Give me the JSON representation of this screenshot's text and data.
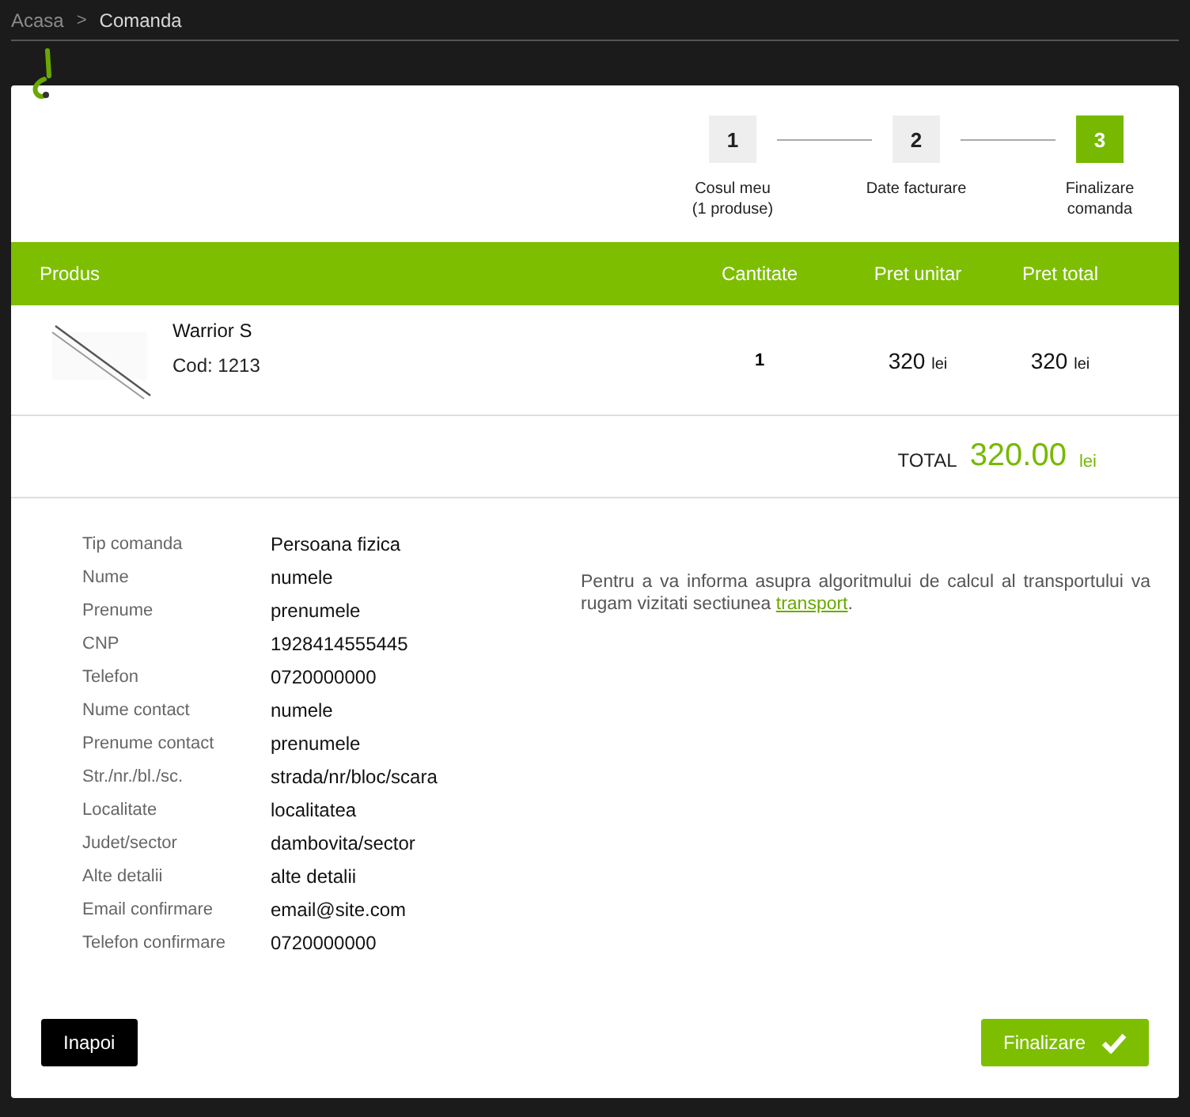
{
  "breadcrumb": [
    {
      "label": "Acasa",
      "selected": false
    },
    {
      "label": "Comanda",
      "selected": true
    }
  ],
  "breadcrumb_separator": ">",
  "steps": [
    {
      "number": "1",
      "label": "Cosul meu",
      "sublabel": "(1 produse)",
      "selected": false
    },
    {
      "number": "2",
      "label": "Date facturare",
      "selected": false
    },
    {
      "number": "3",
      "label": "Finalizare",
      "sublabel": "comanda",
      "selected": true
    }
  ],
  "table": {
    "columns": [
      "Produs",
      "Cantitate",
      "Pret unitar",
      "Pret total"
    ],
    "rows": [
      {
        "name": "Warrior S",
        "code": "Cod: 1213",
        "quantity": "1",
        "unit_price": "320",
        "unit_currency": "lei",
        "total_price": "320",
        "total_currency": "lei"
      }
    ]
  },
  "total": {
    "label": "TOTAL",
    "amount": "320.00",
    "currency": "lei"
  },
  "details": [
    {
      "label": "Tip comanda",
      "value": "Persoana fizica"
    },
    {
      "label": "Nume",
      "value": "numele"
    },
    {
      "label": "Prenume",
      "value": "prenumele"
    },
    {
      "label": "CNP",
      "value": "1928414555445"
    },
    {
      "label": "Telefon",
      "value": "0720000000"
    },
    {
      "label": "Nume contact",
      "value": "numele"
    },
    {
      "label": "Prenume contact",
      "value": "prenumele"
    },
    {
      "label": "Str./nr./bl./sc.",
      "value": "strada/nr/bloc/scara"
    },
    {
      "label": "Localitate",
      "value": "localitatea"
    },
    {
      "label": "Judet/sector",
      "value": "dambovita/sector"
    },
    {
      "label": "Alte detalii",
      "value": "alte detalii"
    },
    {
      "label": "Email confirmare",
      "value": "email@site.com"
    },
    {
      "label": "Telefon confirmare",
      "value": "0720000000"
    }
  ],
  "info": {
    "text": "Pentru a va informa asupra algoritmului de calcul al transportului va rugam vizitati sectiunea ",
    "link": "transport",
    "after": "."
  },
  "buttons": {
    "back": "Inapoi",
    "finish": "Finalizare"
  }
}
